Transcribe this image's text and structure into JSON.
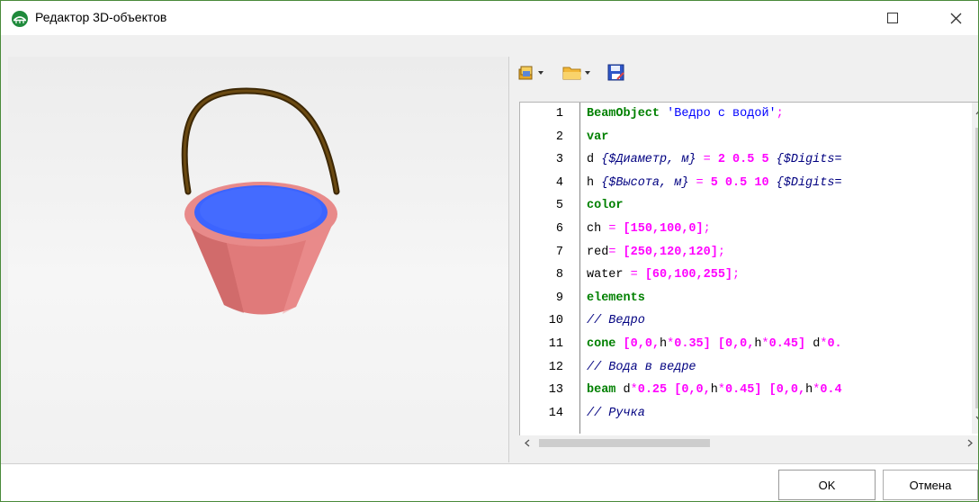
{
  "window": {
    "title": "Редактор 3D-объектов",
    "icons": {
      "app": "bridge-icon",
      "maximize": "maximize-icon",
      "close": "close-icon"
    }
  },
  "toolbar": {
    "items": [
      {
        "icon": "library-icon",
        "has_dropdown": true
      },
      {
        "icon": "open-folder-icon",
        "has_dropdown": true
      },
      {
        "icon": "save-icon",
        "has_dropdown": false
      }
    ]
  },
  "editor": {
    "lines": [
      {
        "n": "1",
        "tokens": [
          [
            "kw",
            "BeamObject"
          ],
          [
            "p",
            " "
          ],
          [
            "str",
            "'Ведро с водой'"
          ],
          [
            "op",
            ";"
          ]
        ]
      },
      {
        "n": "2",
        "tokens": [
          [
            "kw",
            "var"
          ]
        ]
      },
      {
        "n": "3",
        "tokens": [
          [
            "p",
            "d "
          ],
          [
            "cm",
            "{$Диаметр, м}"
          ],
          [
            "op",
            " = "
          ],
          [
            "num",
            "2 0.5 5"
          ],
          [
            "p",
            " "
          ],
          [
            "cm",
            "{$Digits="
          ]
        ]
      },
      {
        "n": "4",
        "tokens": [
          [
            "p",
            "h "
          ],
          [
            "cm",
            "{$Высота, м}"
          ],
          [
            "op",
            " = "
          ],
          [
            "num",
            "5 0.5 10"
          ],
          [
            "p",
            " "
          ],
          [
            "cm",
            "{$Digits="
          ]
        ]
      },
      {
        "n": "5",
        "tokens": [
          [
            "kw",
            "color"
          ]
        ]
      },
      {
        "n": "6",
        "tokens": [
          [
            "p",
            "ch "
          ],
          [
            "op",
            "= "
          ],
          [
            "num",
            "[150,100,0]"
          ],
          [
            "op",
            ";"
          ]
        ]
      },
      {
        "n": "7",
        "tokens": [
          [
            "p",
            "red"
          ],
          [
            "op",
            "= "
          ],
          [
            "num",
            "[250,120,120]"
          ],
          [
            "op",
            ";"
          ]
        ]
      },
      {
        "n": "8",
        "tokens": [
          [
            "p",
            "water "
          ],
          [
            "op",
            "= "
          ],
          [
            "num",
            "[60,100,255]"
          ],
          [
            "op",
            ";"
          ]
        ]
      },
      {
        "n": "9",
        "tokens": [
          [
            "kw",
            "elements"
          ]
        ]
      },
      {
        "n": "10",
        "tokens": [
          [
            "cm",
            "// Ведро"
          ]
        ]
      },
      {
        "n": "11",
        "tokens": [
          [
            "kw",
            "cone"
          ],
          [
            "p",
            " "
          ],
          [
            "num",
            "[0,0,"
          ],
          [
            "p",
            "h"
          ],
          [
            "op",
            "*"
          ],
          [
            "num",
            "0.35]"
          ],
          [
            "p",
            " "
          ],
          [
            "num",
            "[0,0,"
          ],
          [
            "p",
            "h"
          ],
          [
            "op",
            "*"
          ],
          [
            "num",
            "0.45]"
          ],
          [
            "p",
            " d"
          ],
          [
            "op",
            "*"
          ],
          [
            "num",
            "0."
          ]
        ]
      },
      {
        "n": "12",
        "tokens": [
          [
            "cm",
            "// Вода в ведре"
          ]
        ]
      },
      {
        "n": "13",
        "tokens": [
          [
            "kw",
            "beam"
          ],
          [
            "p",
            " d"
          ],
          [
            "op",
            "*"
          ],
          [
            "num",
            "0.25"
          ],
          [
            "p",
            " "
          ],
          [
            "num",
            "[0,0,"
          ],
          [
            "p",
            "h"
          ],
          [
            "op",
            "*"
          ],
          [
            "num",
            "0.45]"
          ],
          [
            "p",
            " "
          ],
          [
            "num",
            "[0,0,"
          ],
          [
            "p",
            "h"
          ],
          [
            "op",
            "*"
          ],
          [
            "num",
            "0.4"
          ]
        ]
      },
      {
        "n": "14",
        "tokens": [
          [
            "cm",
            "// Ручка"
          ]
        ]
      }
    ]
  },
  "buttons": {
    "ok": "OK",
    "cancel": "Отмена"
  },
  "colors": {
    "handle": "#5a3c0a",
    "bucket": "#e07878",
    "water": "#3c64ff",
    "frame": "#4a8a3a"
  }
}
